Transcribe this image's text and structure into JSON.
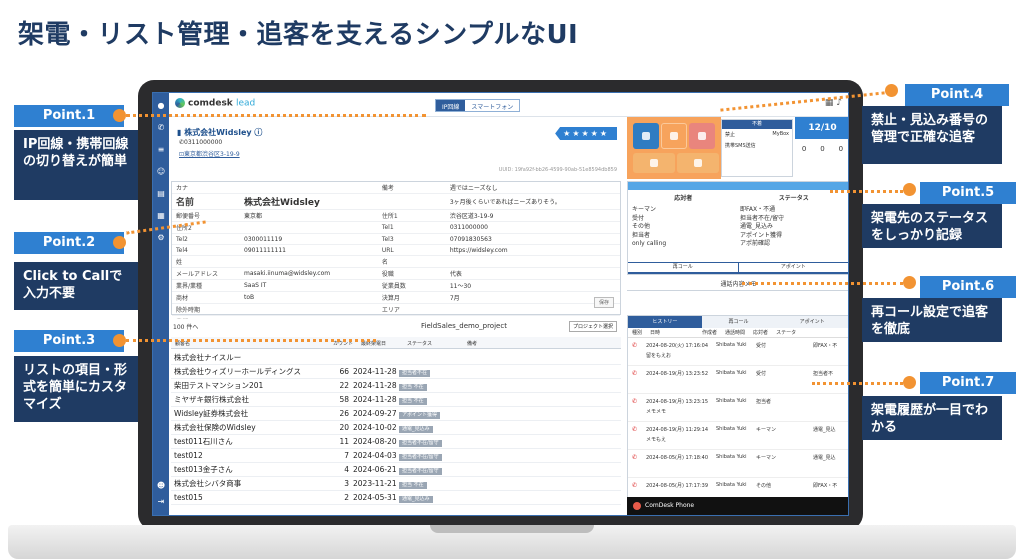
{
  "headline": "架電・リスト管理・追客を支えるシンプルなUI",
  "app": {
    "logo_text": "comdesk",
    "logo_sub": "lead",
    "line_tabs": [
      "IP回線",
      "スマートフォン"
    ],
    "company": {
      "name": "株式会社Widsley",
      "tel": "0311000000",
      "address": "東京都渋谷区3-19-9",
      "stars": "★★★★★",
      "uuid": "UUID: 19fa92f-bb26-4599-90ab-51e8594db859"
    },
    "details": [
      [
        "カナ",
        "",
        "備考",
        "週ではニーズなし"
      ],
      [
        "名前",
        "株式会社Widsley",
        "",
        "3ヶ月後くらいであればニーズありそう。"
      ],
      [
        "郵便番号",
        "東京都",
        "住所1",
        "渋谷区道3-19-9"
      ],
      [
        "住所2",
        "",
        "Tel1",
        "0311000000"
      ],
      [
        "Tel2",
        "0300011119",
        "Tel3",
        "07091830563"
      ],
      [
        "Tel4",
        "09011111111",
        "URL",
        "https://widsley.com"
      ],
      [
        "姓",
        "",
        "名",
        ""
      ],
      [
        "メールアドレス",
        "masaki.iinuma@widsley.com",
        "役職",
        "代表"
      ],
      [
        "業界/業種",
        "SaaS IT",
        "従業員数",
        "11〜30"
      ],
      [
        "商材",
        "toB",
        "決算月",
        "7月"
      ],
      [
        "除外時期",
        "",
        "エリア",
        ""
      ],
      [
        "業種",
        "",
        "テスト",
        ""
      ]
    ],
    "save_label": "保存",
    "list_toolbar": {
      "count": "100 件へ",
      "project": "FieldSales_demo_project",
      "select_button": "プロジェクト選択",
      "columns": [
        "顧客名",
        "カウント",
        "最終架電日",
        "ステータス",
        "備考"
      ]
    },
    "list_rows": [
      [
        "株式会社ナイスルー",
        "",
        "",
        "",
        ""
      ],
      [
        "株式会社ウィズリーホールディングス",
        "66",
        "2024-11-28",
        "担当者不在",
        ""
      ],
      [
        "柴田テストマンション201",
        "22",
        "2024-11-28",
        "担当 不在",
        ""
      ],
      [
        "ミヤザキ銀行株式会社",
        "58",
        "2024-11-28",
        "担当 不在",
        ""
      ],
      [
        "Widsley証券株式会社",
        "26",
        "2024-09-27",
        "アポイント獲得",
        ""
      ],
      [
        "株式会社保険のWidsley",
        "20",
        "2024-10-02",
        "通電_見込み",
        ""
      ],
      [
        "test011石川さん",
        "11",
        "2024-08-20",
        "担当者不在/留守",
        ""
      ],
      [
        "test012",
        "7",
        "2024-04-03",
        "担当者不在/留守",
        ""
      ],
      [
        "test013金子さん",
        "4",
        "2024-06-21",
        "担当者不在/留守",
        ""
      ],
      [
        "株式会社シバタ商事",
        "3",
        "2023-11-21",
        "担当 不在",
        ""
      ],
      [
        "test015",
        "2",
        "2024-05-31",
        "通電_見込み",
        ""
      ]
    ],
    "control_panel": {
      "header": "不着",
      "rows": [
        [
          "禁止",
          "MyBox"
        ],
        [
          "携帯SMS送信",
          ""
        ]
      ]
    },
    "counter": {
      "value": "12/10",
      "cells": [
        "0",
        "0",
        "0"
      ]
    },
    "status_panel": {
      "title": "架電",
      "col_left": "応対者",
      "col_right": "ステータス",
      "respondents": [
        "キーマン",
        "受付",
        "その他",
        "担当者",
        "only calling"
      ],
      "statuses": [
        "即FAX・不通",
        "担当者不在/留守",
        "通電_見込み",
        "アポイント獲得",
        "アポ前確認"
      ],
      "actions": [
        "再コール",
        "アポイント"
      ]
    },
    "memo_label": "通話内容メモ",
    "history": {
      "tabs": [
        "ヒストリー",
        "再コール",
        "アポイント"
      ],
      "columns": [
        "種別",
        "日時",
        "作成者",
        "通話時間",
        "応対者",
        "ステータ"
      ],
      "rows": [
        [
          "2024-08-20(火) 17:16:04",
          "Shibata Yuki",
          "受付",
          "即FAX・不",
          "留をもえお"
        ],
        [
          "2024-08-19(月) 13:23:52",
          "Shibata Yuki",
          "受付",
          "担当者不",
          ""
        ],
        [
          "2024-08-19(月) 13:23:15",
          "Shibata Yuki",
          "担当者",
          "",
          "メモメモ"
        ],
        [
          "2024-08-19(月) 11:29:14",
          "Shibata Yuki",
          "キーマン",
          "通電_見込",
          "メモもえ"
        ],
        [
          "2024-08-05(月) 17:18:40",
          "Shibata Yuki",
          "キーマン",
          "通電_見込",
          ""
        ],
        [
          "2024-08-05(月) 17:17:39",
          "Shibata Yuki",
          "その他",
          "即FAX・不",
          ""
        ]
      ]
    },
    "phone_bar": "ComDesk Phone"
  },
  "callouts": [
    {
      "tag": "Point.1",
      "text": "IP回線・携帯回線の切り替えが簡単"
    },
    {
      "tag": "Point.2",
      "text": "Click to Callで入力不要"
    },
    {
      "tag": "Point.3",
      "text": "リストの項目・形式を簡単にカスタマイズ"
    },
    {
      "tag": "Point.4",
      "text": "禁止・見込み番号の管理で正確な追客"
    },
    {
      "tag": "Point.5",
      "text": "架電先のステータスをしっかり記録"
    },
    {
      "tag": "Point.6",
      "text": "再コール設定で追客を徹底"
    },
    {
      "tag": "Point.7",
      "text": "架電履歴が一目でわかる"
    }
  ],
  "colors": {
    "accent_blue": "#2f80d1",
    "navy": "#1f3b63",
    "orange": "#f29332"
  }
}
